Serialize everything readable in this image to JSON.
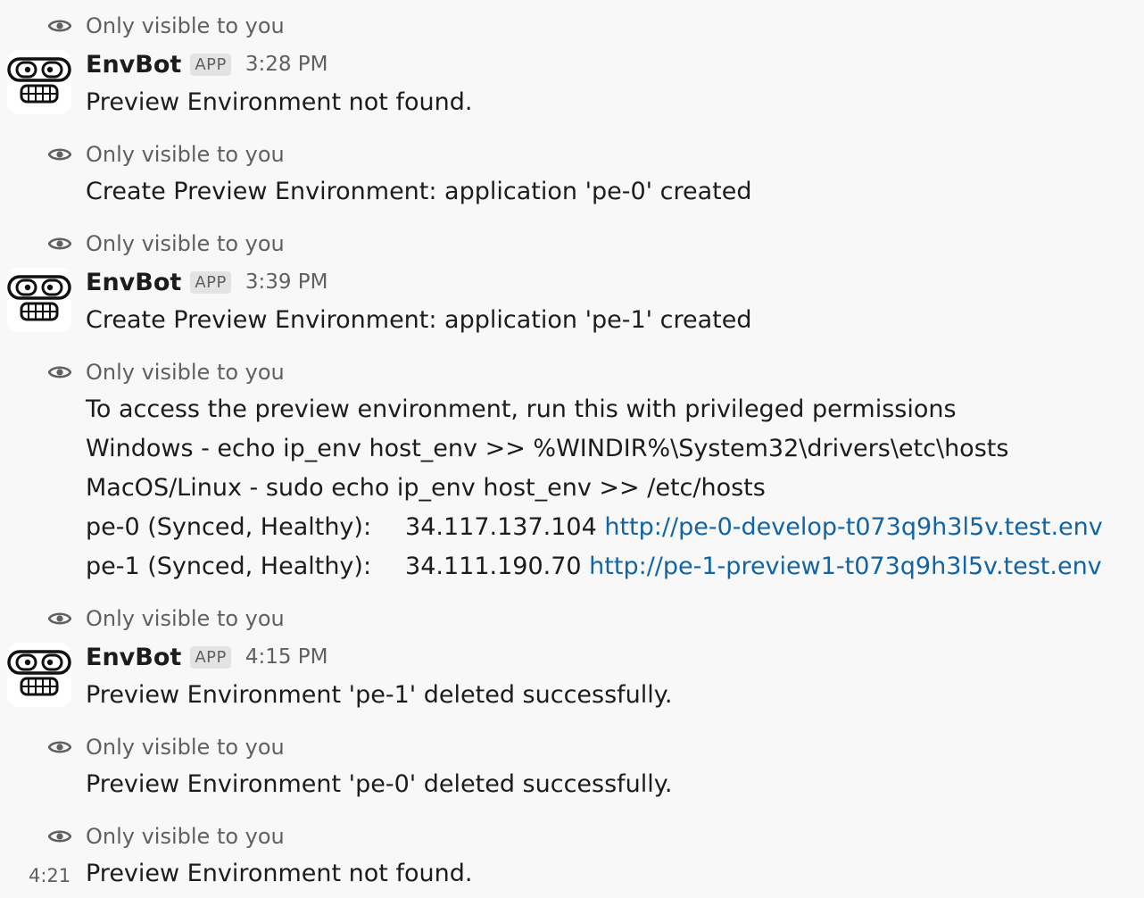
{
  "ephemeral_label": "Only visible to you",
  "bot": {
    "name": "EnvBot",
    "badge": "APP"
  },
  "groups": [
    {
      "time": "3:28 PM",
      "text": "Preview Environment not found."
    },
    {
      "time": "3:39 PM",
      "text": "Create Preview Environment: application 'pe-1' created"
    },
    {
      "time": "4:15 PM",
      "text": "Preview Environment 'pe-1' deleted successfully."
    }
  ],
  "messages": {
    "create_pe0": "Create Preview Environment: application 'pe-0' created",
    "access": {
      "intro": "To access the preview environment, run this with privileged permissions",
      "windows": "Windows - echo ip_env host_env >> %WINDIR%\\System32\\drivers\\etc\\hosts",
      "macos": "MacOS/Linux - sudo echo ip_env host_env >> /etc/hosts",
      "envs": [
        {
          "label": "pe-0 (Synced, Healthy):",
          "ip": "34.117.137.104",
          "url": "http://pe-0-develop-t073q9h3l5v.test.env"
        },
        {
          "label": "pe-1 (Synced, Healthy):",
          "ip": "34.111.190.70",
          "url": "http://pe-1-preview1-t073q9h3l5v.test.env"
        }
      ]
    },
    "deleted_pe0": "Preview Environment 'pe-0' deleted successfully.",
    "last": {
      "time": "4:21",
      "text": "Preview Environment not found."
    }
  }
}
